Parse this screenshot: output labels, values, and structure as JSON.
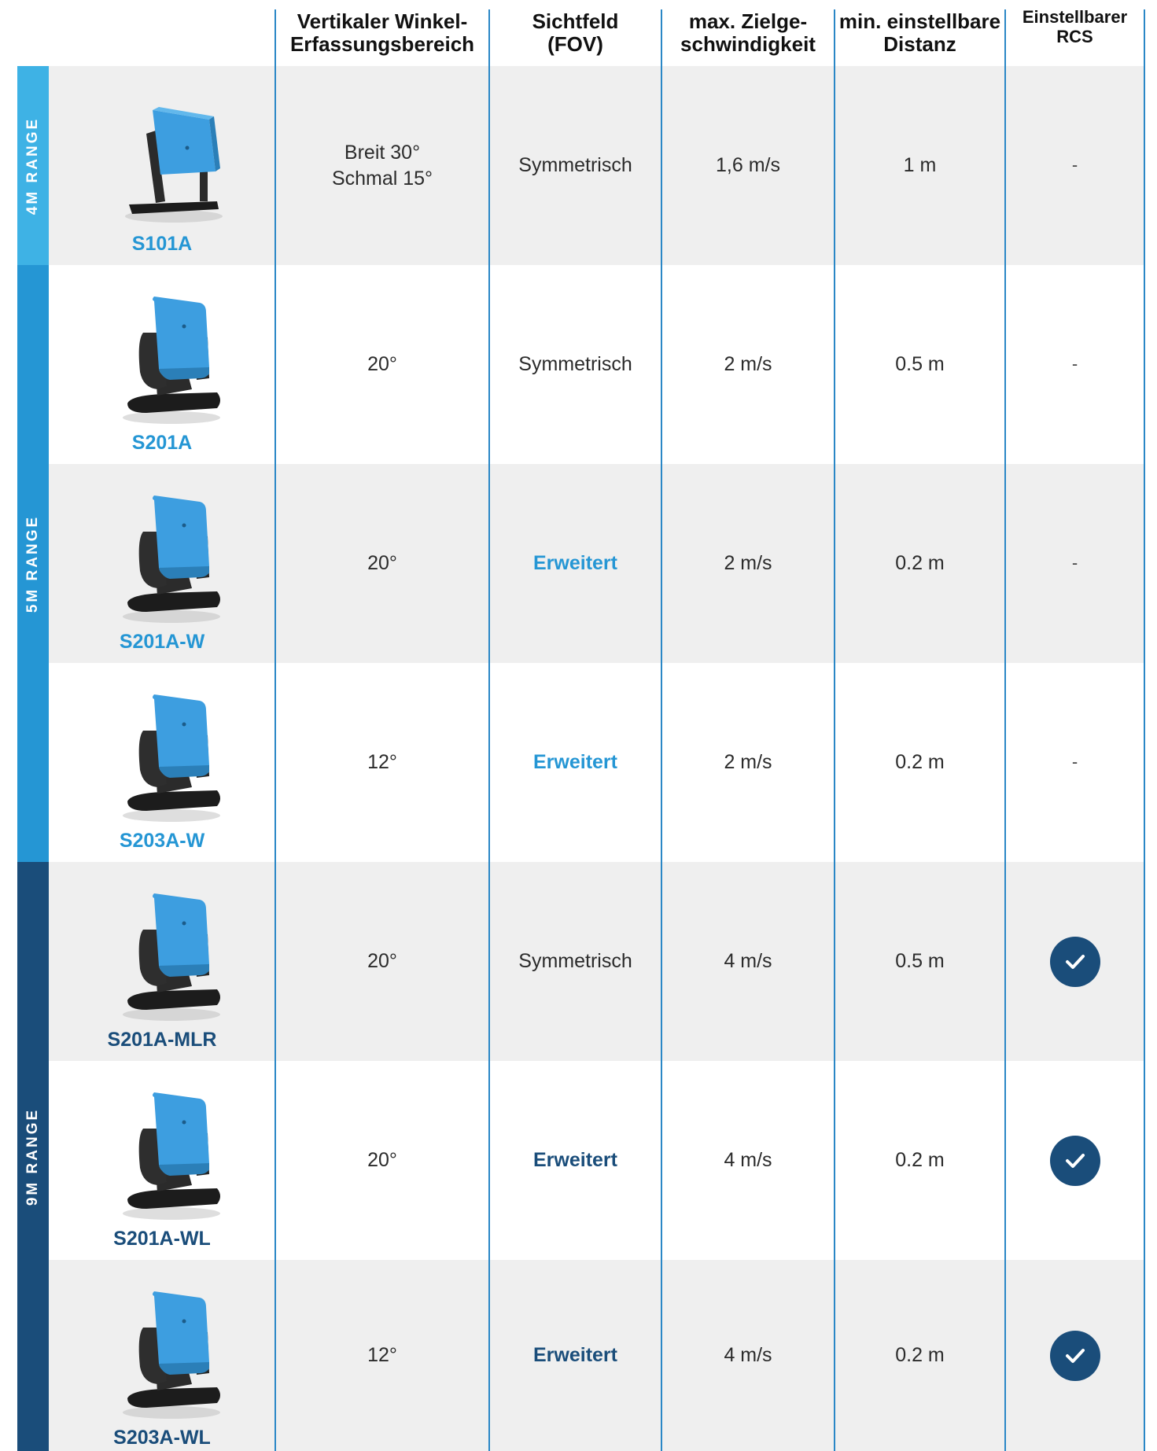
{
  "header": {
    "col1": [
      "Vertikaler Winkel-",
      "Erfassungsbereich"
    ],
    "col2": [
      "Sichtfeld",
      "(FOV)"
    ],
    "col3": [
      "max. Zielge-",
      "schwindigkeit"
    ],
    "col4": [
      "min. einstellbare",
      "Distanz"
    ],
    "col5": [
      "Einstellbarer",
      "RCS"
    ]
  },
  "groups": [
    {
      "label": "4M RANGE",
      "color": "#3eb2e5"
    },
    {
      "label": "5M RANGE",
      "color": "#2596d4"
    },
    {
      "label": "9M RANGE",
      "color": "#1a4d7a"
    }
  ],
  "rows": [
    {
      "model": "S101A",
      "model_color": "#2596d4",
      "vertical": [
        "Breit 30°",
        "Schmal 15°"
      ],
      "fov": "Symmetrisch",
      "fov_bold": false,
      "speed": "1,6 m/s",
      "distance": "1 m",
      "rcs": "-",
      "rcs_check": false
    },
    {
      "model": "S201A",
      "model_color": "#2596d4",
      "vertical": [
        "20°"
      ],
      "fov": "Symmetrisch",
      "fov_bold": false,
      "speed": "2 m/s",
      "distance": "0.5 m",
      "rcs": "-",
      "rcs_check": false
    },
    {
      "model": "S201A-W",
      "model_color": "#2596d4",
      "vertical": [
        "20°"
      ],
      "fov": "Erweitert",
      "fov_bold": true,
      "speed": "2 m/s",
      "distance": "0.2 m",
      "rcs": "-",
      "rcs_check": false
    },
    {
      "model": "S203A-W",
      "model_color": "#2596d4",
      "vertical": [
        "12°"
      ],
      "fov": "Erweitert",
      "fov_bold": true,
      "speed": "2 m/s",
      "distance": "0.2 m",
      "rcs": "-",
      "rcs_check": false
    },
    {
      "model": "S201A-MLR",
      "model_color": "#1a4d7a",
      "vertical": [
        "20°"
      ],
      "fov": "Symmetrisch",
      "fov_bold": false,
      "speed": "4 m/s",
      "distance": "0.5 m",
      "rcs": "",
      "rcs_check": true
    },
    {
      "model": "S201A-WL",
      "model_color": "#1a4d7a",
      "vertical": [
        "20°"
      ],
      "fov": "Erweitert",
      "fov_bold": true,
      "speed": "4 m/s",
      "distance": "0.2 m",
      "rcs": "",
      "rcs_check": true
    },
    {
      "model": "S203A-WL",
      "model_color": "#1a4d7a",
      "vertical": [
        "12°"
      ],
      "fov": "Erweitert",
      "fov_bold": true,
      "speed": "4 m/s",
      "distance": "0.2 m",
      "rcs": "",
      "rcs_check": true
    }
  ],
  "colors": {
    "header_line": "#2a87c6",
    "row_shade": "#efefef",
    "fov_5m": "#2596d4",
    "fov_9m": "#1a4d7a",
    "check_bg": "#1a4d7a",
    "sensor_blue": "#3d9ee0"
  }
}
